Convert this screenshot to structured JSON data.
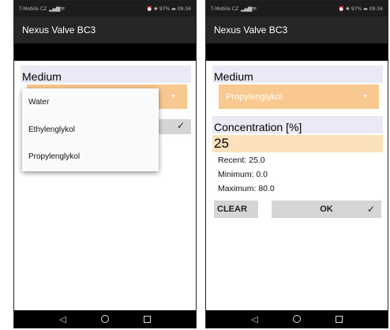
{
  "status": {
    "carrier": "T-Mobile CZ",
    "battery": "97%",
    "time": "09:34",
    "icons": "⏰ ✱"
  },
  "app": {
    "title": "Nexus Valve BC3"
  },
  "left": {
    "medium_label": "Medium",
    "dropdown_options": [
      "Water",
      "Ethylenglykol",
      "Propylenglykol"
    ]
  },
  "right": {
    "medium_label": "Medium",
    "medium_value": "Propylenglykol",
    "concentration_label": "Concentration [%]",
    "concentration_value": "25",
    "recent": "Recent: 25.0",
    "minimum": "Minimum: 0.0",
    "maximum": "Maximum: 80.0",
    "clear_label": "CLEAR",
    "ok_label": "OK"
  },
  "icons": {
    "check": "checkmark-icon",
    "caret": "caret-down-icon",
    "back": "back-icon",
    "home": "home-icon",
    "recents": "recents-icon"
  },
  "colors": {
    "spinner": "#f9c890",
    "value_field": "#fbe2bd",
    "label_bg": "#eaeaf6",
    "appbar": "#262626"
  }
}
